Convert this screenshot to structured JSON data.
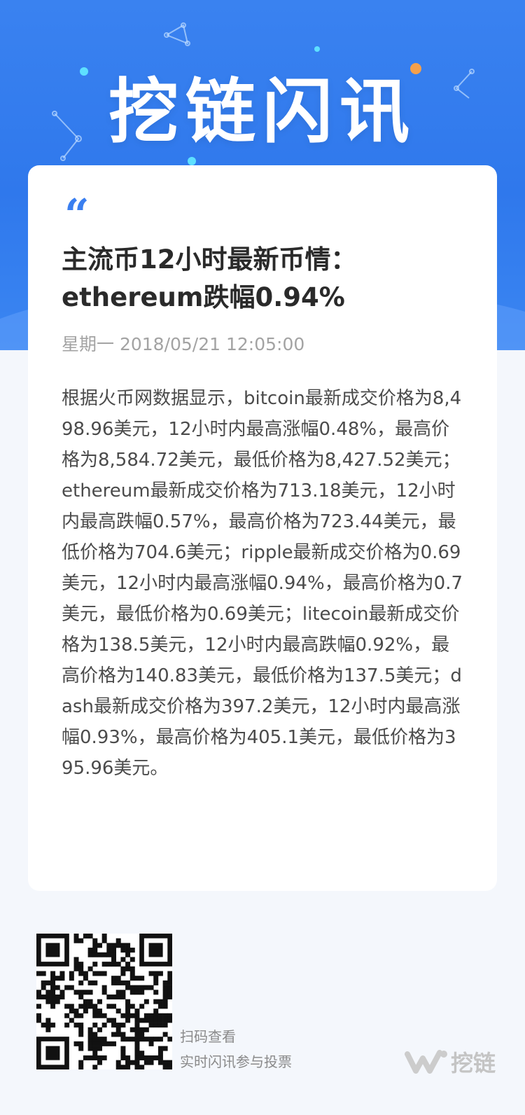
{
  "hero": {
    "title": "挖链闪讯"
  },
  "article": {
    "quote_mark": "“",
    "headline": "主流币12小时最新币情：ethereum跌幅0.94%",
    "dateline": "星期一 2018/05/21 12:05:00",
    "body": "根据火币网数据显示，bitcoin最新成交价格为8,498.96美元，12小时内最高涨幅0.48%，最高价格为8,584.72美元，最低价格为8,427.52美元；ethereum最新成交价格为713.18美元，12小时内最高跌幅0.57%，最高价格为723.44美元，最低价格为704.6美元；ripple最新成交价格为0.69美元，12小时内最高涨幅0.94%，最高价格为0.7美元，最低价格为0.69美元；litecoin最新成交价格为138.5美元，12小时内最高跌幅0.92%，最高价格为140.83美元，最低价格为137.5美元；dash最新成交价格为397.2美元，12小时内最高涨幅0.93%，最高价格为405.1美元，最低价格为395.96美元。"
  },
  "footer": {
    "scan_line_1": "扫码查看",
    "scan_line_2": "实时闪讯参与投票",
    "brand_text": "挖链",
    "qr_icon": "qr-code-icon",
    "brand_icon": "wakuang-logo-icon"
  },
  "colors": {
    "hero_blue": "#3a82f0",
    "accent_blue": "#3a7ff0",
    "deco_orange": "#f5a04b",
    "deco_cyan": "#5ee0ff"
  }
}
